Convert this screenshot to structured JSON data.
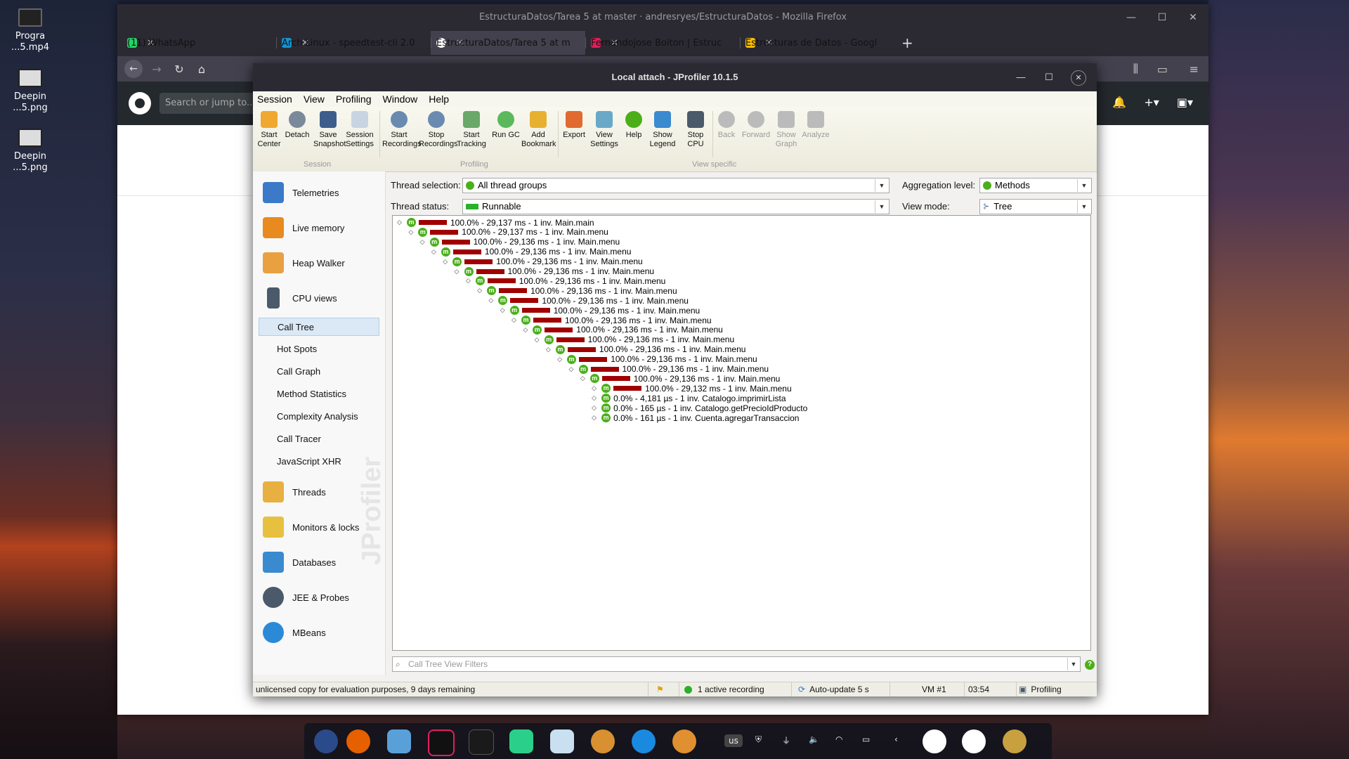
{
  "desktop": {
    "icons": [
      {
        "label": "Progra\n...5.mp4"
      },
      {
        "label": "Deepin\n...5.png"
      },
      {
        "label": "Deepin\n...5.png"
      }
    ]
  },
  "firefox": {
    "title": "EstructuraDatos/Tarea 5 at master · andresryes/EstructuraDatos - Mozilla Firefox",
    "tabs": [
      {
        "label": "(11) WhatsApp",
        "color": "#25d366"
      },
      {
        "label": "Arch Linux - speedtest-cli 2.0",
        "color": "#1793d1"
      },
      {
        "label": "EstructuraDatos/Tarea 5 at m",
        "color": "#ffffff"
      },
      {
        "label": "Fernandojose Boiton | Estruc",
        "color": "#e01e5a"
      },
      {
        "label": "Estructuras de Datos - Googl",
        "color": "#fbbc04"
      }
    ],
    "github_search_placeholder": "Search or jump to..."
  },
  "jprofiler": {
    "title": "Local attach - JProfiler 10.1.5",
    "menu": [
      "Session",
      "View",
      "Profiling",
      "Window",
      "Help"
    ],
    "toolbar": {
      "buttons": [
        {
          "label1": "Start",
          "label2": "Center"
        },
        {
          "label1": "Detach",
          "label2": ""
        },
        {
          "label1": "Save",
          "label2": "Snapshot"
        },
        {
          "label1": "Session",
          "label2": "Settings"
        },
        {
          "label1": "Start",
          "label2": "Recordings"
        },
        {
          "label1": "Stop",
          "label2": "Recordings"
        },
        {
          "label1": "Start",
          "label2": "Tracking"
        },
        {
          "label1": "Run GC",
          "label2": ""
        },
        {
          "label1": "Add",
          "label2": "Bookmark"
        },
        {
          "label1": "Export",
          "label2": ""
        },
        {
          "label1": "View",
          "label2": "Settings"
        },
        {
          "label1": "Help",
          "label2": ""
        },
        {
          "label1": "Show",
          "label2": "Legend"
        },
        {
          "label1": "Stop",
          "label2": "CPU"
        },
        {
          "label1": "Back",
          "label2": ""
        },
        {
          "label1": "Forward",
          "label2": ""
        },
        {
          "label1": "Show",
          "label2": "Graph"
        },
        {
          "label1": "Analyze",
          "label2": ""
        }
      ],
      "groups": [
        "Session",
        "Profiling",
        "View specific"
      ]
    },
    "nav": {
      "sections": [
        "Telemetries",
        "Live memory",
        "Heap Walker",
        "CPU views",
        "Threads",
        "Monitors & locks",
        "Databases",
        "JEE & Probes",
        "MBeans"
      ],
      "cpu_views": [
        "Call Tree",
        "Hot Spots",
        "Call Graph",
        "Method Statistics",
        "Complexity Analysis",
        "Call Tracer",
        "JavaScript XHR"
      ],
      "selected": "Call Tree",
      "watermark": "JProfiler"
    },
    "controls": {
      "thread_selection_label": "Thread selection:",
      "thread_selection_value": "All thread groups",
      "thread_status_label": "Thread status:",
      "thread_status_value": "Runnable",
      "aggregation_label": "Aggregation level:",
      "aggregation_value": "Methods",
      "view_mode_label": "View mode:",
      "view_mode_value": "Tree"
    },
    "call_tree": [
      {
        "depth": 0,
        "text": "100.0% - 29,137 ms - 1 inv. Main.main",
        "pct": 1.0
      },
      {
        "depth": 1,
        "text": "100.0% - 29,137 ms - 1 inv. Main.menu",
        "pct": 1.0
      },
      {
        "depth": 2,
        "text": "100.0% - 29,136 ms - 1 inv. Main.menu",
        "pct": 1.0
      },
      {
        "depth": 3,
        "text": "100.0% - 29,136 ms - 1 inv. Main.menu",
        "pct": 1.0
      },
      {
        "depth": 4,
        "text": "100.0% - 29,136 ms - 1 inv. Main.menu",
        "pct": 1.0
      },
      {
        "depth": 5,
        "text": "100.0% - 29,136 ms - 1 inv. Main.menu",
        "pct": 1.0
      },
      {
        "depth": 6,
        "text": "100.0% - 29,136 ms - 1 inv. Main.menu",
        "pct": 1.0
      },
      {
        "depth": 7,
        "text": "100.0% - 29,136 ms - 1 inv. Main.menu",
        "pct": 1.0
      },
      {
        "depth": 8,
        "text": "100.0% - 29,136 ms - 1 inv. Main.menu",
        "pct": 1.0
      },
      {
        "depth": 9,
        "text": "100.0% - 29,136 ms - 1 inv. Main.menu",
        "pct": 1.0
      },
      {
        "depth": 10,
        "text": "100.0% - 29,136 ms - 1 inv. Main.menu",
        "pct": 1.0
      },
      {
        "depth": 11,
        "text": "100.0% - 29,136 ms - 1 inv. Main.menu",
        "pct": 1.0
      },
      {
        "depth": 12,
        "text": "100.0% - 29,136 ms - 1 inv. Main.menu",
        "pct": 1.0
      },
      {
        "depth": 13,
        "text": "100.0% - 29,136 ms - 1 inv. Main.menu",
        "pct": 1.0
      },
      {
        "depth": 14,
        "text": "100.0% - 29,136 ms - 1 inv. Main.menu",
        "pct": 1.0
      },
      {
        "depth": 15,
        "text": "100.0% - 29,136 ms - 1 inv. Main.menu",
        "pct": 1.0
      },
      {
        "depth": 16,
        "text": "100.0% - 29,136 ms - 1 inv. Main.menu",
        "pct": 1.0
      },
      {
        "depth": 17,
        "text": "100.0% - 29,132 ms - 1 inv. Main.menu",
        "pct": 1.0
      },
      {
        "depth": 17,
        "text": "0.0% - 4,181 µs - 1 inv. Catalogo.imprimirLista",
        "pct": 0.0
      },
      {
        "depth": 17,
        "text": "0.0% - 165 µs - 1 inv. Catalogo.getPrecioIdProducto",
        "pct": 0.0
      },
      {
        "depth": 17,
        "text": "0.0% - 161 µs - 1 inv. Cuenta.agregarTransaccion",
        "pct": 0.0
      }
    ],
    "filter_placeholder": "Call Tree View Filters",
    "status": {
      "license": "unlicensed copy for evaluation purposes, 9 days remaining",
      "recording": "1 active recording",
      "autoupdate": "Auto-update 5 s",
      "vm": "VM #1",
      "time": "03:54",
      "mode": "Profiling"
    }
  },
  "dock": {
    "keyboard": "us"
  },
  "colors": {
    "bar": "#a00000",
    "method_icon": "#4caf1a"
  }
}
